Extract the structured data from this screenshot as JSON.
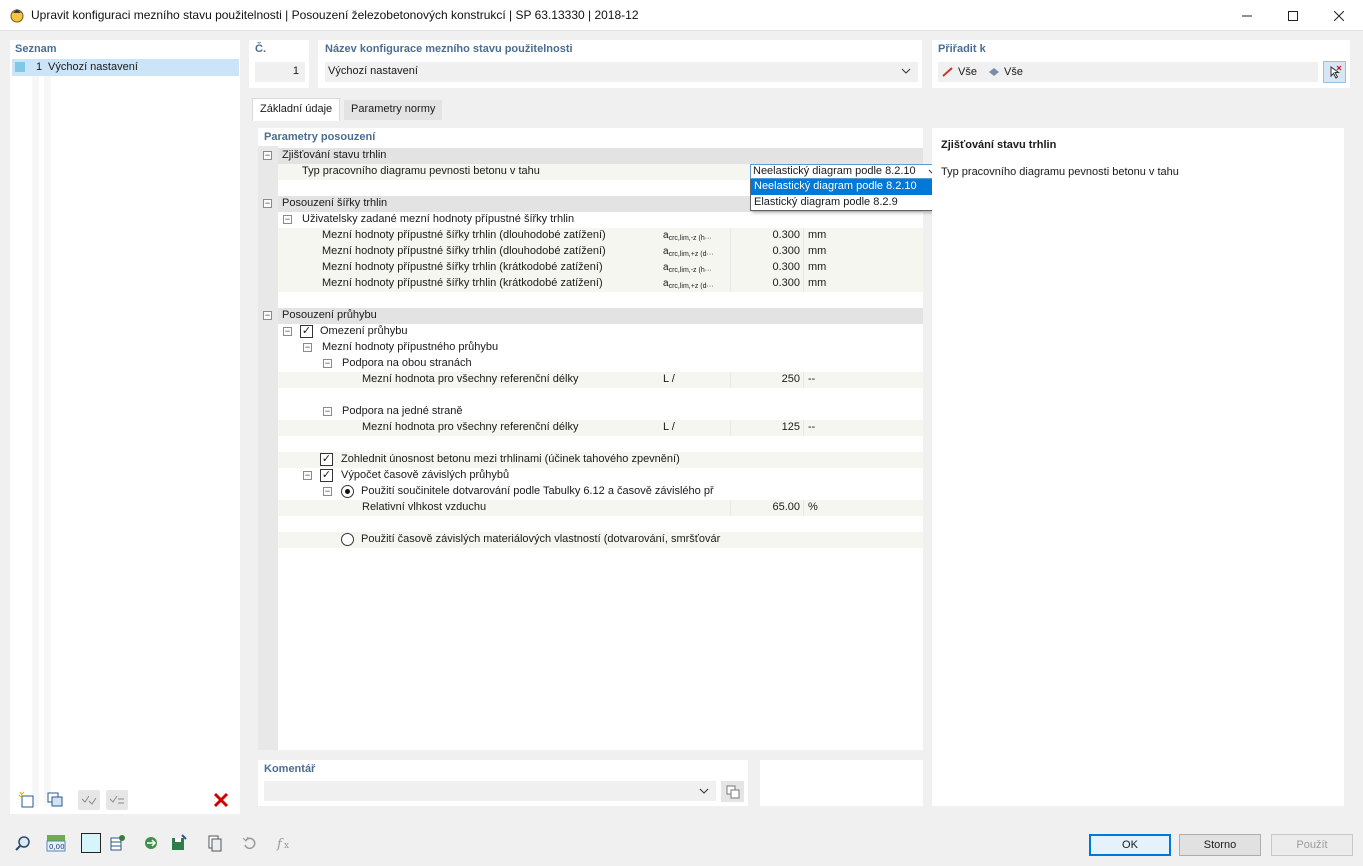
{
  "window": {
    "title": "Upravit konfiguraci mezního stavu použitelnosti | Posouzení železobetonových konstrukcí | SP 63.13330 | 2018-12"
  },
  "list": {
    "title": "Seznam",
    "items": [
      {
        "num": "1",
        "label": "Výchozí nastavení"
      }
    ]
  },
  "number": {
    "title": "Č.",
    "value": "1"
  },
  "config_name": {
    "title": "Název konfigurace mezního stavu použitelnosti",
    "value": "Výchozí nastavení"
  },
  "assign": {
    "title": "Přiřadit k",
    "item1": "Vše",
    "item2": "Vše"
  },
  "tabs": [
    {
      "label": "Základní údaje",
      "active": true
    },
    {
      "label": "Parametry normy",
      "active": false
    }
  ],
  "params": {
    "title": "Parametry posouzení",
    "crack_detection": {
      "label": "Zjišťování stavu trhlin",
      "type_label": "Typ pracovního diagramu pevnosti betonu v tahu",
      "selected": "Neelastický diagram podle 8.2.10",
      "options": [
        "Neelastický diagram podle 8.2.10",
        "Elastický diagram podle 8.2.9"
      ]
    },
    "crack_width": {
      "label": "Posouzení šířky trhlin",
      "user_limits_label": "Uživatelsky zadané mezní hodnoty přípustné šířky trhlin",
      "rows": [
        {
          "label": "Mezní hodnoty přípustné šířky trhlin (dlouhodobé zatížení)",
          "sym_main": "a",
          "sym_sub": "crc,lim,-z (h···",
          "value": "0.300",
          "unit": "mm"
        },
        {
          "label": "Mezní hodnoty přípustné šířky trhlin (dlouhodobé zatížení)",
          "sym_main": "a",
          "sym_sub": "crc,lim,+z (d···",
          "value": "0.300",
          "unit": "mm"
        },
        {
          "label": "Mezní hodnoty přípustné šířky trhlin (krátkodobé zatížení)",
          "sym_main": "a",
          "sym_sub": "crc,lim,-z (h···",
          "value": "0.300",
          "unit": "mm"
        },
        {
          "label": "Mezní hodnoty přípustné šířky trhlin (krátkodobé zatížení)",
          "sym_main": "a",
          "sym_sub": "crc,lim,+z (d···",
          "value": "0.300",
          "unit": "mm"
        }
      ]
    },
    "deflection": {
      "label": "Posouzení průhybu",
      "limit_label": "Omezení průhybu",
      "limit_checked": true,
      "limit_values_label": "Mezní hodnoty přípustného průhybu",
      "both_sides_label": "Podpora na obou stranách",
      "both_sides_row": {
        "label": "Mezní hodnota pro všechny referenční délky",
        "sym": "L /",
        "value": "250",
        "unit": "--"
      },
      "one_side_label": "Podpora na jedné straně",
      "one_side_row": {
        "label": "Mezní hodnota pro všechny referenční délky",
        "sym": "L /",
        "value": "125",
        "unit": "--"
      },
      "tension_stiffening_label": "Zohlednit únosnost betonu mezi trhlinami (účinek tahového zpevnění)",
      "tension_stiffening_checked": true,
      "time_dependent_label": "Výpočet časově závislých průhybů",
      "time_dependent_checked": true,
      "method1_label": "Použití součinitele dotvarování podle Tabulky 6.12 a časově závislého př",
      "humidity_row": {
        "label": "Relativní vlhkost vzduchu",
        "value": "65.00",
        "unit": "%"
      },
      "method2_label": "Použití časově závislých materiálových vlastností (dotvarování, smršťovár"
    }
  },
  "info": {
    "title": "Zjišťování stavu trhlin",
    "text": "Typ pracovního diagramu pevnosti betonu v tahu"
  },
  "comment": {
    "title": "Komentář",
    "value": ""
  },
  "buttons": {
    "ok": "OK",
    "cancel": "Storno",
    "apply": "Použít"
  },
  "colors": {
    "accent": "#0078d7",
    "title_blue": "#4a6e93",
    "selection": "#cce4f7"
  }
}
